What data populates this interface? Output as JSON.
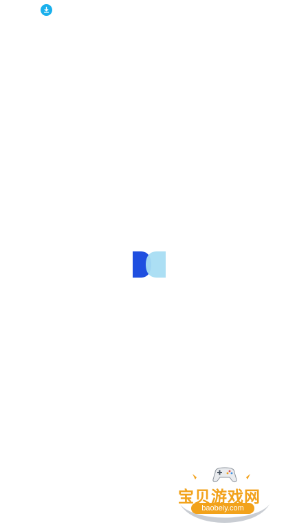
{
  "status_bar": {
    "download_icon": "download-icon",
    "download_color": "#1ab0ec"
  },
  "splash": {
    "logo_icon": "app-logo-icon",
    "logo_colors": {
      "dark": "#1f4fe0",
      "light": "#a8ddf3"
    }
  },
  "watermark": {
    "title": "宝贝游戏网",
    "url": "baobeiy.com",
    "icon": "gamepad-icon",
    "color": "#f2a21b"
  }
}
